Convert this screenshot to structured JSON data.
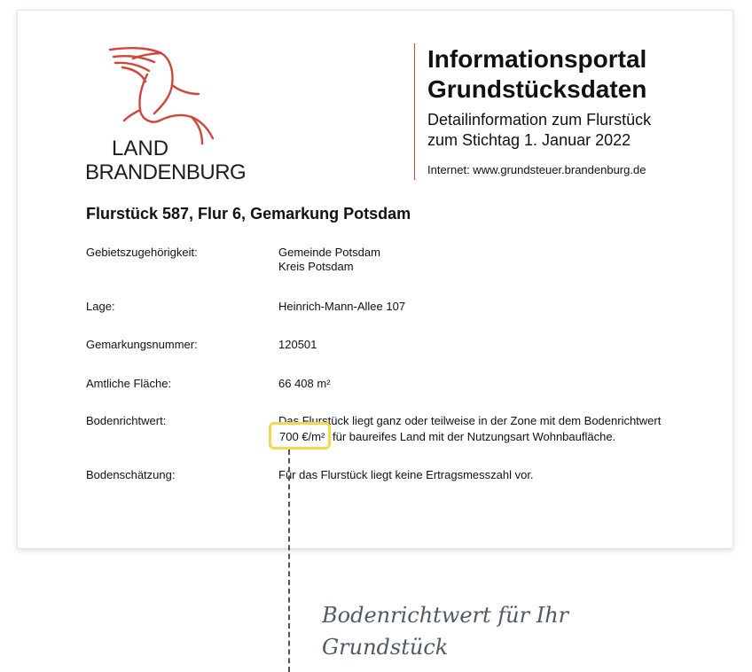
{
  "logo": {
    "line1": "LAND",
    "line2": "BRANDENBURG",
    "icon": "eagle-icon",
    "color": "#d2453a"
  },
  "portal": {
    "title_line1": "Informationsportal",
    "title_line2": "Grundstücksdaten",
    "subtitle_line1": "Detailinformation zum Flurstück",
    "subtitle_line2": "zum Stichtag 1. Januar 2022",
    "website": "Internet: www.grundsteuer.brandenburg.de"
  },
  "parcel": {
    "heading": "Flurstück 587, Flur 6, Gemarkung Potsdam",
    "rows": [
      {
        "label": "Gebietszugehörigkeit:",
        "value_line1": "Gemeinde Potsdam",
        "value_line2": "Kreis Potsdam"
      },
      {
        "label": "Lage:",
        "value": "Heinrich-Mann-Allee 107"
      },
      {
        "label": "Gemarkungsnummer:",
        "value": "120501"
      },
      {
        "label": "Amtliche Fläche:",
        "value": "66 408 m²"
      },
      {
        "label": "Bodenrichtwert:",
        "value_line1": "Das Flurstück liegt ganz oder teilweise in der Zone mit dem Bodenrichtwert",
        "value_line2_highlight": "700 €/m²",
        "value_line2_rest": "für baureifes Land mit der Nutzungsart Wohnbaufläche."
      },
      {
        "label": "Bodenschätzung:",
        "value": "Für das Flurstück liegt keine Ertragsmesszahl vor."
      }
    ]
  },
  "annotation": {
    "caption_line1": "Bodenrichtwert für Ihr",
    "caption_line2": "Grundstück",
    "highlight_color": "#f2d84a"
  }
}
